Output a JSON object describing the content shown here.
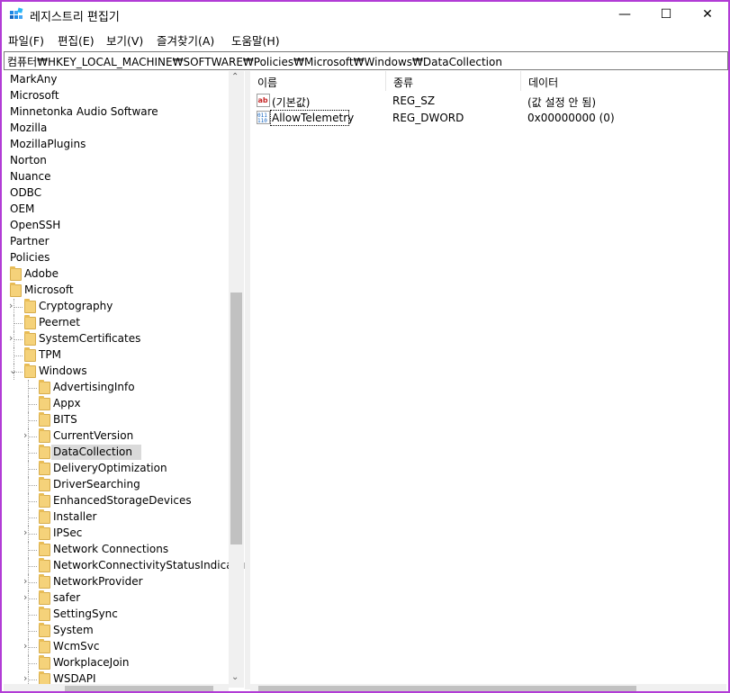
{
  "window": {
    "title": "레지스트리 편집기",
    "controls": {
      "minimize": "—",
      "maximize": "☐",
      "close": "✕"
    }
  },
  "menu": [
    {
      "label": "파일(F)"
    },
    {
      "label": "편집(E)"
    },
    {
      "label": "보기(V)"
    },
    {
      "label": "즐겨찾기(A)"
    },
    {
      "label": "도움말(H)"
    }
  ],
  "address": "컴퓨터₩HKEY_LOCAL_MACHINE₩SOFTWARE₩Policies₩Microsoft₩Windows₩DataCollection",
  "tree": [
    {
      "label": "MarkAny",
      "level": 0,
      "folder": false,
      "chevron": ""
    },
    {
      "label": "Microsoft",
      "level": 0,
      "folder": false,
      "chevron": ""
    },
    {
      "label": "Minnetonka Audio Software",
      "level": 0,
      "folder": false,
      "chevron": ""
    },
    {
      "label": "Mozilla",
      "level": 0,
      "folder": false,
      "chevron": ""
    },
    {
      "label": "MozillaPlugins",
      "level": 0,
      "folder": false,
      "chevron": ""
    },
    {
      "label": "Norton",
      "level": 0,
      "folder": false,
      "chevron": ""
    },
    {
      "label": "Nuance",
      "level": 0,
      "folder": false,
      "chevron": ""
    },
    {
      "label": "ODBC",
      "level": 0,
      "folder": false,
      "chevron": ""
    },
    {
      "label": "OEM",
      "level": 0,
      "folder": false,
      "chevron": ""
    },
    {
      "label": "OpenSSH",
      "level": 0,
      "folder": false,
      "chevron": ""
    },
    {
      "label": "Partner",
      "level": 0,
      "folder": false,
      "chevron": ""
    },
    {
      "label": "Policies",
      "level": 0,
      "folder": false,
      "chevron": ""
    },
    {
      "label": "Adobe",
      "level": 1,
      "folder": true,
      "chevron": ""
    },
    {
      "label": "Microsoft",
      "level": 1,
      "folder": true,
      "chevron": ""
    },
    {
      "label": "Cryptography",
      "level": 2,
      "folder": true,
      "chevron": "›"
    },
    {
      "label": "Peernet",
      "level": 2,
      "folder": true,
      "chevron": ""
    },
    {
      "label": "SystemCertificates",
      "level": 2,
      "folder": true,
      "chevron": "›"
    },
    {
      "label": "TPM",
      "level": 2,
      "folder": true,
      "chevron": ""
    },
    {
      "label": "Windows",
      "level": 2,
      "folder": true,
      "chevron": "⌄"
    },
    {
      "label": "AdvertisingInfo",
      "level": 3,
      "folder": true,
      "chevron": ""
    },
    {
      "label": "Appx",
      "level": 3,
      "folder": true,
      "chevron": ""
    },
    {
      "label": "BITS",
      "level": 3,
      "folder": true,
      "chevron": ""
    },
    {
      "label": "CurrentVersion",
      "level": 3,
      "folder": true,
      "chevron": "›"
    },
    {
      "label": "DataCollection",
      "level": 3,
      "folder": true,
      "chevron": "",
      "selected": true
    },
    {
      "label": "DeliveryOptimization",
      "level": 3,
      "folder": true,
      "chevron": ""
    },
    {
      "label": "DriverSearching",
      "level": 3,
      "folder": true,
      "chevron": ""
    },
    {
      "label": "EnhancedStorageDevices",
      "level": 3,
      "folder": true,
      "chevron": ""
    },
    {
      "label": "Installer",
      "level": 3,
      "folder": true,
      "chevron": ""
    },
    {
      "label": "IPSec",
      "level": 3,
      "folder": true,
      "chevron": "›"
    },
    {
      "label": "Network Connections",
      "level": 3,
      "folder": true,
      "chevron": ""
    },
    {
      "label": "NetworkConnectivityStatusIndicator",
      "level": 3,
      "folder": true,
      "chevron": ""
    },
    {
      "label": "NetworkProvider",
      "level": 3,
      "folder": true,
      "chevron": "›"
    },
    {
      "label": "safer",
      "level": 3,
      "folder": true,
      "chevron": "›"
    },
    {
      "label": "SettingSync",
      "level": 3,
      "folder": true,
      "chevron": ""
    },
    {
      "label": "System",
      "level": 3,
      "folder": true,
      "chevron": ""
    },
    {
      "label": "WcmSvc",
      "level": 3,
      "folder": true,
      "chevron": "›"
    },
    {
      "label": "WorkplaceJoin",
      "level": 3,
      "folder": true,
      "chevron": ""
    },
    {
      "label": "WSDAPI",
      "level": 3,
      "folder": true,
      "chevron": "›"
    }
  ],
  "list": {
    "columns": [
      "이름",
      "종류",
      "데이터"
    ],
    "rows": [
      {
        "name": "(기본값)",
        "type": "REG_SZ",
        "data": "(값 설정 안 됨)",
        "icon": "string-value-icon"
      },
      {
        "name": "AllowTelemetry",
        "type": "REG_DWORD",
        "data": "0x00000000 (0)",
        "icon": "binary-value-icon"
      }
    ]
  },
  "colors": {
    "frame": "#b23cd6",
    "selection": "#dadada",
    "folder": "#f5d27a"
  }
}
